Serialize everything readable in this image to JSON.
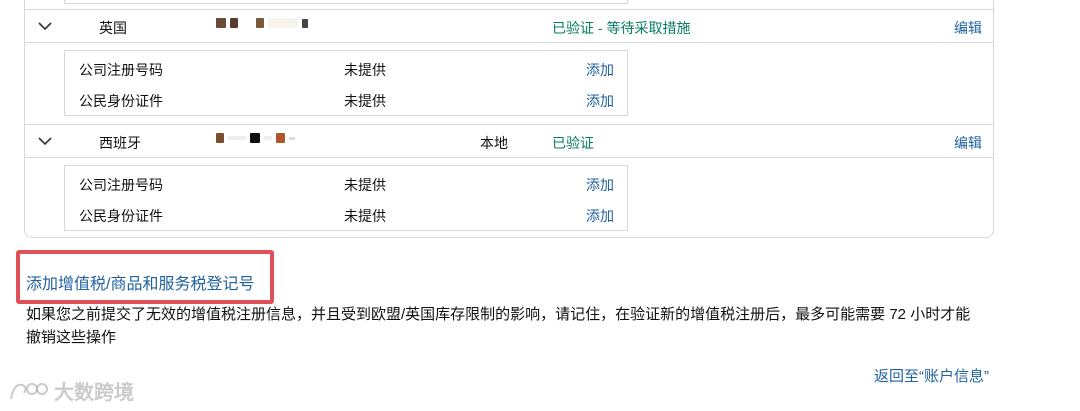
{
  "vat_list": [
    {
      "country": "英国",
      "local": "",
      "status": "已验证 - 等待采取措施",
      "edit_label": "编辑",
      "docs": [
        {
          "label": "公司注册号码",
          "value": "未提供",
          "action": "添加"
        },
        {
          "label": "公民身份证件",
          "value": "未提供",
          "action": "添加"
        }
      ]
    },
    {
      "country": "西班牙",
      "local": "本地",
      "status": "已验证",
      "edit_label": "编辑",
      "docs": [
        {
          "label": "公司注册号码",
          "value": "未提供",
          "action": "添加"
        },
        {
          "label": "公民身份证件",
          "value": "未提供",
          "action": "添加"
        }
      ]
    }
  ],
  "add_vat_link": "添加增值税/商品和服务税登记号",
  "note": "如果您之前提交了无效的增值税注册信息，并且受到欧盟/英国库存限制的影响，请记住，在验证新的增值税注册后，最多可能需要 72 小时才能撤销这些操作",
  "back_link": "返回至“账户信息”",
  "watermark": "大数跨境",
  "colors": {
    "link": "#2162a1",
    "verified": "#067d62",
    "highlight_box": "#e05057",
    "border": "#d5d9d9"
  }
}
